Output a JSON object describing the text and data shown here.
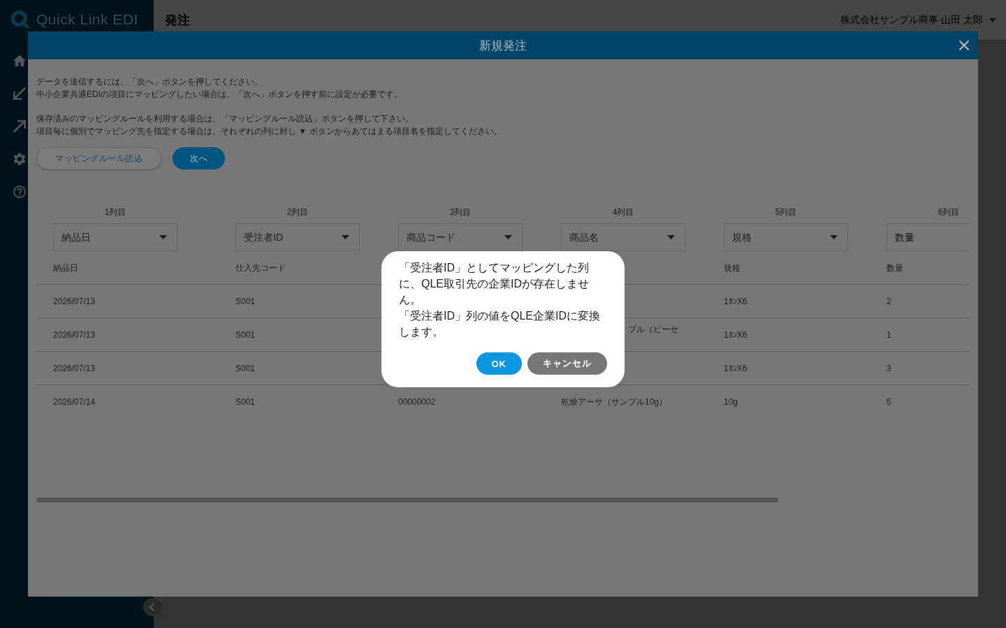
{
  "sidebar": {
    "logo": "Quick Link EDI"
  },
  "header": {
    "title": "発注",
    "user": "株式会社サンプル商事 山田 太郎"
  },
  "modal": {
    "title": "新規発注",
    "instructions": [
      {
        "lines": [
          "データを送信するには、「次へ」ボタンを押してください。",
          "中小企業共通EDIの項目にマッピングしたい場合は、「次へ」ボタンを押す前に設定が必要です。"
        ]
      },
      {
        "lines": [
          "保存済みのマッピングルールを利用する場合は、「マッピングルール読込」ボタンを押して下さい。",
          "項目毎に個別でマッピング先を指定する場合は、それぞれの列に対し ▼ ボタンからあてはまる項目名を指定してください。"
        ]
      }
    ],
    "buttons": [
      {
        "label": "マッピングルール読込",
        "kind": "outline"
      },
      {
        "label": "次へ",
        "kind": "primary"
      }
    ],
    "table": {
      "columns": [
        {
          "label": "1列目",
          "mapping": "納品日",
          "header": "納品日"
        },
        {
          "label": "2列目",
          "mapping": "受注者ID",
          "header": "仕入先コード"
        },
        {
          "label": "3列目",
          "mapping": "商品コード"
        },
        {
          "label": "4列目",
          "mapping": "商品名"
        },
        {
          "label": "5列目",
          "mapping": "規格",
          "header": "規格"
        },
        {
          "label": "6列目",
          "mapping": "数量",
          "header": "数量"
        }
      ],
      "rows": [
        {
          "cells": [
            "2026/07/13",
            "S001",
            null,
            null,
            "1ｶﾝX6",
            "2"
          ]
        },
        {
          "cells": [
            "2026/07/13",
            "S001",
            null,
            {
              "text": "プル（ピーセ",
              "kind": "partly_covered"
            },
            "1ｶﾝX6",
            "1"
          ]
        },
        {
          "cells": [
            "2026/07/13",
            "S001",
            null,
            null,
            "1ｶﾝX6",
            "3"
          ]
        },
        {
          "cells": [
            "2026/07/14",
            "S001",
            "00000002",
            "乾燥アーサ（サンプル10g）",
            "10g",
            "5"
          ]
        }
      ]
    }
  },
  "dialog": {
    "message": [
      "「受注者ID」としてマッピングした列に、QLE取引先の企業IDが存在しません。",
      "「受注者ID」列の値をQLE企業IDに変換します。"
    ],
    "buttons": [
      {
        "label": "OK",
        "kind": "primary"
      },
      {
        "label": "キャンセル",
        "kind": "secondary"
      }
    ]
  }
}
